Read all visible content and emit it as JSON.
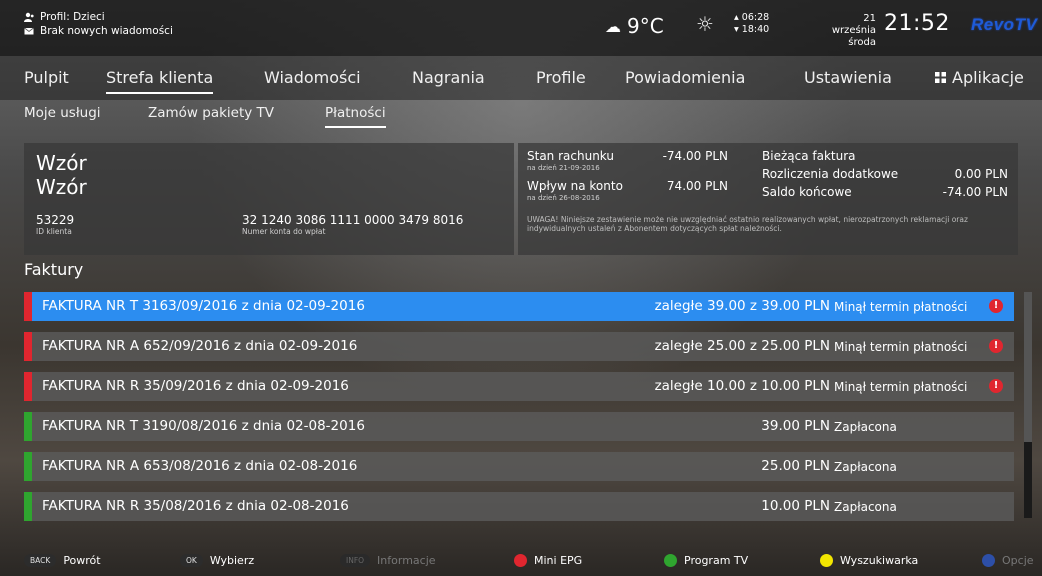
{
  "topbar": {
    "profile_label": "Profil: Dzieci",
    "messages_label": "Brak nowych wiadomości",
    "temperature": "9°C",
    "sunrise": "06:28",
    "sunset": "18:40",
    "date_line1": "21 września",
    "date_line2": "środa",
    "time": "21:52",
    "logo": "RevoTV"
  },
  "mainnav": {
    "items": [
      {
        "label": "Pulpit"
      },
      {
        "label": "Strefa klienta"
      },
      {
        "label": "Wiadomości"
      },
      {
        "label": "Nagrania"
      },
      {
        "label": "Profile"
      },
      {
        "label": "Powiadomienia"
      },
      {
        "label": "Ustawienia"
      },
      {
        "label": "Aplikacje"
      }
    ],
    "active": "Strefa klienta"
  },
  "subnav": {
    "items": [
      {
        "label": "Moje usługi"
      },
      {
        "label": "Zamów pakiety TV"
      },
      {
        "label": "Płatności"
      }
    ],
    "active": "Płatności"
  },
  "client": {
    "name_line1": "Wzór",
    "name_line2": "Wzór",
    "client_id": "53229",
    "client_id_label": "ID klienta",
    "account_number": "32 1240 3086 1111 0000 3479 8016",
    "account_number_label": "Numer konta do wpłat"
  },
  "balance": {
    "status_label": "Stan rachunku",
    "status_date": "na dzień 21-09-2016",
    "status_value": "-74.00 PLN",
    "inflow_label": "Wpływ na konto",
    "inflow_date": "na dzień 26-08-2016",
    "inflow_value": "74.00 PLN",
    "current_invoice_label": "Bieżąca faktura",
    "extra_label": "Rozliczenia dodatkowe",
    "extra_value": "0.00 PLN",
    "final_label": "Saldo końcowe",
    "final_value": "-74.00 PLN",
    "warning": "UWAGA! Niniejsze zestawienie może nie uwzględniać ostatnio realizowanych wpłat, nierozpatrzonych reklamacji oraz indywidualnych ustaleń z Abonentem dotyczących spłat należności."
  },
  "invoices": {
    "title": "Faktury",
    "items": [
      {
        "title": "FAKTURA NR T 3163/09/2016 z dnia 02-09-2016",
        "amount": "zaległe 39.00 z 39.00 PLN",
        "status": "Minął termin płatności",
        "overdue": true,
        "stripe": "#e0262f"
      },
      {
        "title": "FAKTURA NR A 652/09/2016 z dnia 02-09-2016",
        "amount": "zaległe 25.00 z 25.00 PLN",
        "status": "Minął termin płatności",
        "overdue": true,
        "stripe": "#e0262f"
      },
      {
        "title": "FAKTURA NR R 35/09/2016 z dnia 02-09-2016",
        "amount": "zaległe 10.00 z 10.00 PLN",
        "status": "Minął termin płatności",
        "overdue": true,
        "stripe": "#e0262f"
      },
      {
        "title": "FAKTURA NR T 3190/08/2016 z dnia 02-08-2016",
        "amount": "39.00 PLN",
        "status": "Zapłacona",
        "overdue": false,
        "stripe": "#2fa52f"
      },
      {
        "title": "FAKTURA NR A 653/08/2016 z dnia 02-08-2016",
        "amount": "25.00 PLN",
        "status": "Zapłacona",
        "overdue": false,
        "stripe": "#2fa52f"
      },
      {
        "title": "FAKTURA NR R 35/08/2016 z dnia 02-08-2016",
        "amount": "10.00 PLN",
        "status": "Zapłacona",
        "overdue": false,
        "stripe": "#2fa52f"
      }
    ],
    "alert_glyph": "!"
  },
  "footer": {
    "back_key": "BACK",
    "back_label": "Powrót",
    "ok_key": "OK",
    "ok_label": "Wybierz",
    "info_key": "INFO",
    "info_label": "Informacje",
    "red_label": "Mini EPG",
    "green_label": "Program TV",
    "yellow_label": "Wyszukiwarka",
    "blue_label": "Opcje"
  },
  "colors": {
    "selected": "#2c8df0",
    "overdue": "#e0262f",
    "paid": "#2fa52f",
    "red_button": "#e0262f",
    "green_button": "#2fa52f",
    "yellow_button": "#f2e600",
    "blue_button": "#2d4fa8"
  },
  "icons": {
    "profile": "profile-icon",
    "messages": "envelope-icon",
    "weather": "cloud-icon",
    "sun": "sun-icon",
    "apps": "apps-grid-icon"
  }
}
